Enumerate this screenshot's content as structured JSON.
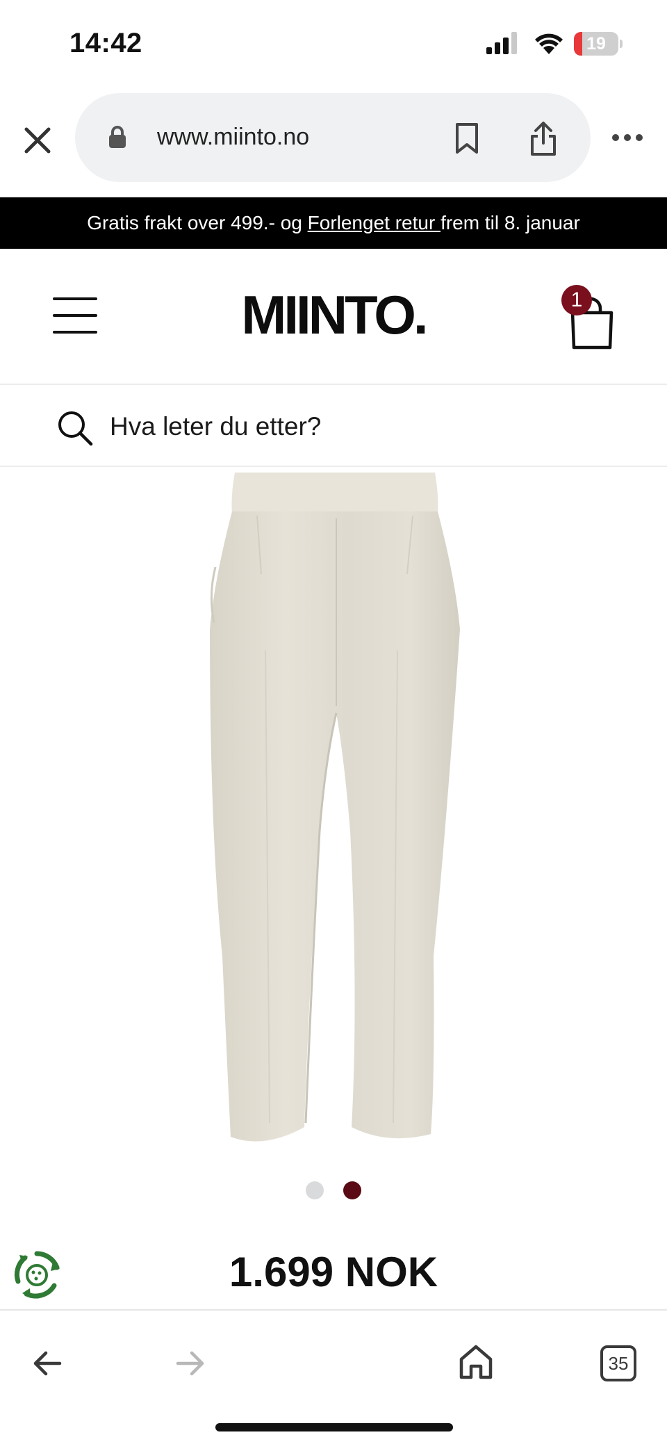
{
  "status_bar": {
    "time": "14:42",
    "battery_level": "19",
    "battery_fraction": 0.19,
    "icons": [
      "signal-icon",
      "wifi-icon",
      "battery-icon"
    ]
  },
  "browser": {
    "url": "www.miinto.no",
    "icons": [
      "close-icon",
      "lock-icon",
      "bookmark-icon",
      "share-icon",
      "more-icon"
    ]
  },
  "promo": {
    "text_before": "Gratis frakt over 499.- og ",
    "link": "Forlenget retur ",
    "text_after": "frem til 8. januar"
  },
  "header": {
    "logo": "MIINTO.",
    "cart_count": "1",
    "icons": [
      "menu-icon",
      "cart-icon"
    ]
  },
  "search": {
    "placeholder": "Hva leter du etter?"
  },
  "product": {
    "image_count": 2,
    "active_image": 2,
    "price": "1.699 NOK"
  },
  "colors": {
    "accent": "#7a0f1d",
    "active_dot": "#5a0a14",
    "inactive_dot": "#d9dadc",
    "banner_bg": "#000000",
    "eco_green": "#2f7a34",
    "product_fabric": "#e4e0d4"
  },
  "bottom_toolbar": {
    "tab_count": "35",
    "icons": [
      "back-icon",
      "forward-icon",
      "home-icon",
      "tabs-icon"
    ]
  }
}
